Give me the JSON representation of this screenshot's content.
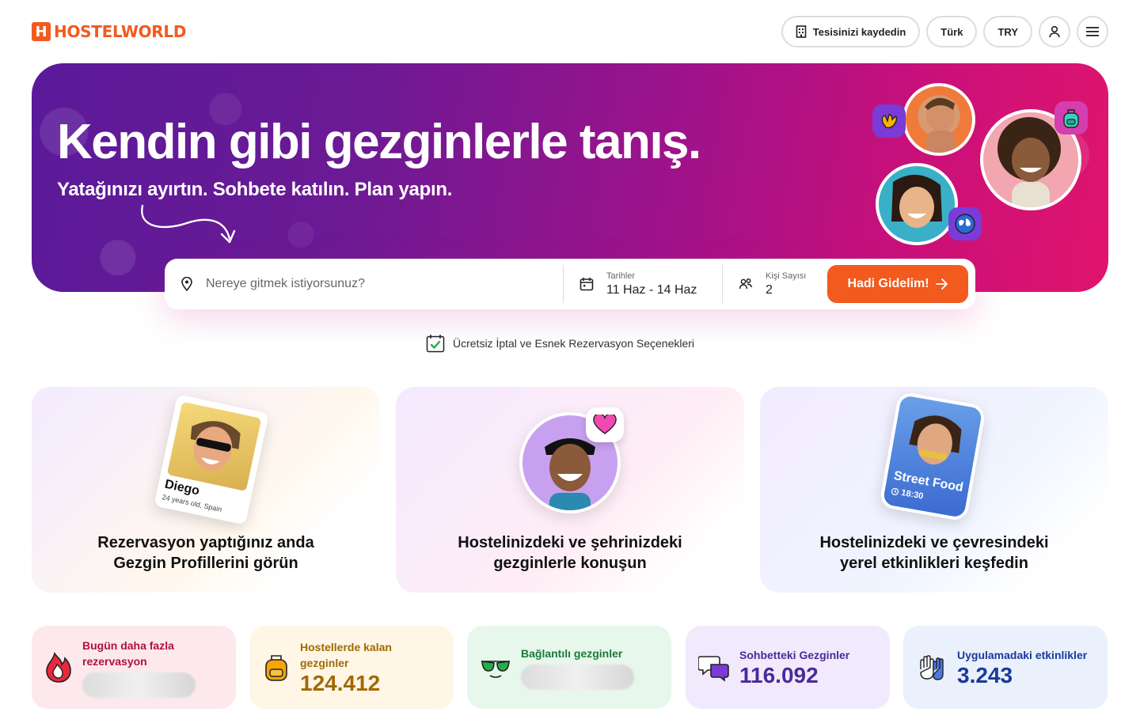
{
  "brand": {
    "logo_text": "HOSTELWORLD",
    "logo_glyph": "H",
    "accent": "#f25a1e"
  },
  "nav": {
    "register_label": "Tesisinizi kaydedin",
    "language_label": "Türk",
    "currency_label": "TRY"
  },
  "hero": {
    "title": "Kendin gibi gezginlerle tanış.",
    "subtitle": "Yatağınızı ayırtın. Sohbete katılın. Plan yapın."
  },
  "search": {
    "destination_placeholder": "Nereye gitmek istiyorsunuz?",
    "dates_label": "Tarihler",
    "dates_value": "11 Haz - 14 Haz",
    "guests_label": "Kişi Sayısı",
    "guests_value": "2",
    "submit_label": "Hadi Gidelim!"
  },
  "notice": {
    "free_cancel": "Ücretsiz İptal ve Esnek Rezervasyon Seçenekleri"
  },
  "features": [
    {
      "title": "Rezervasyon yaptığınız anda Gezgin Profillerini görün",
      "card_name": "Diego",
      "card_meta": "24 years old, Spain"
    },
    {
      "title": "Hostelinizdeki ve şehrinizdeki gezginlerle konuşun"
    },
    {
      "title": "Hostelinizdeki ve çevresindeki yerel etkinlikleri keşfedin",
      "card_name": "Street Food",
      "card_meta": "18:30"
    }
  ],
  "stats": [
    {
      "label": "Bugün daha fazla rezervasyon",
      "value": "",
      "color": "#b0123c",
      "bg": "#fde8ec",
      "icon": "flame-icon"
    },
    {
      "label": "Hostellerde kalan gezginler",
      "value": "124.412",
      "color": "#a06a00",
      "bg": "#fff6e6",
      "icon": "backpack-icon"
    },
    {
      "label": "Bağlantılı gezginler",
      "value": "",
      "color": "#1a7a3a",
      "bg": "#e8f7ec",
      "icon": "sunglasses-icon"
    },
    {
      "label": "Sohbetteki Gezginler",
      "value": "116.092",
      "color": "#4a2a9a",
      "bg": "#f0eafc",
      "icon": "chat-icon"
    },
    {
      "label": "Uygulamadaki etkinlikler",
      "value": "3.243",
      "color": "#1a3a9a",
      "bg": "#eaf0fc",
      "icon": "wave-hand-icon"
    }
  ]
}
